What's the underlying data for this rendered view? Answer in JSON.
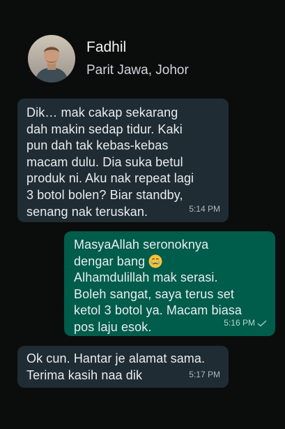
{
  "contact": {
    "name": "Fadhil",
    "location": "Parit Jawa, Johor",
    "avatar_icon": "profile-photo"
  },
  "messages": [
    {
      "direction": "incoming",
      "text": "Dik… mak cakap sekarang\ndah makin sedap tidur. Kaki\npun dah tak kebas-kebas\nmacam dulu. Dia suka betul\nproduk ni. Aku nak repeat lagi\n3 botol bolen? Biar standby,\nsenang nak teruskan.",
      "time": "5:14 PM"
    },
    {
      "direction": "outgoing",
      "text_before_emoji": "MasyaAllah seronoknya\ndengar bang ",
      "emoji": "crying-face",
      "text_after_emoji": "\nAlhamdulillah mak serasi.\nBoleh sangat, saya terus set\nketol 3 botol ya. Macam biasa\npos laju esok.",
      "time": "5:16 PM",
      "status_icon": "delivered-tick"
    },
    {
      "direction": "incoming",
      "text": "Ok cun. Hantar je alamat sama.\nTerima kasih naa dik",
      "time": "5:17 PM"
    }
  ],
  "colors": {
    "background": "#0b0d0d",
    "incoming_bubble": "#1f2c33",
    "outgoing_bubble": "#005c4b"
  }
}
